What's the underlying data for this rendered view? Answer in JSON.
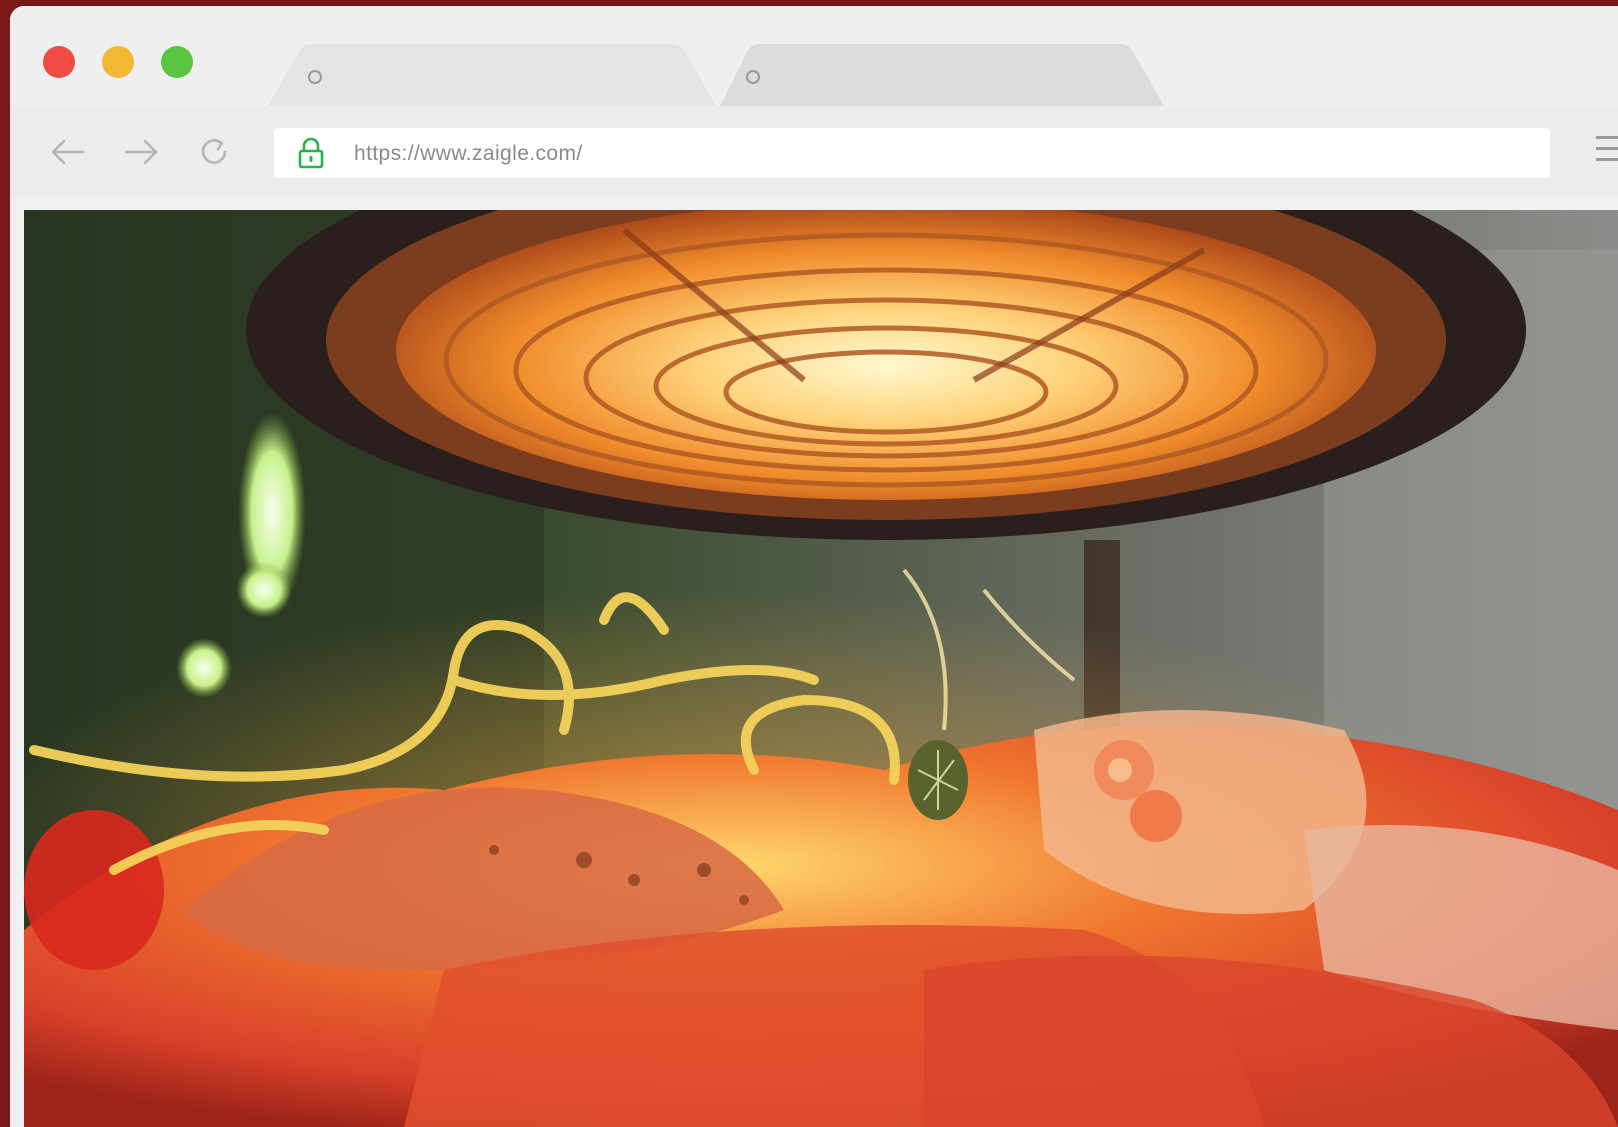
{
  "window": {
    "controls": {
      "close_color": "#ef4a44",
      "minimize_color": "#f2b733",
      "maximize_color": "#5ac540"
    }
  },
  "tabs": [
    {
      "label": "",
      "active": true
    },
    {
      "label": "",
      "active": false
    }
  ],
  "toolbar": {
    "back_icon": "arrow-left-icon",
    "forward_icon": "arrow-right-icon",
    "reload_icon": "reload-icon",
    "menu_icon": "hamburger-menu-icon"
  },
  "address_bar": {
    "url": "https://www.zaigle.com/",
    "secure_icon": "lock-icon",
    "secure_color": "#2bb24c"
  },
  "content": {
    "image_icon": "food-under-heat-lamp-photo"
  }
}
